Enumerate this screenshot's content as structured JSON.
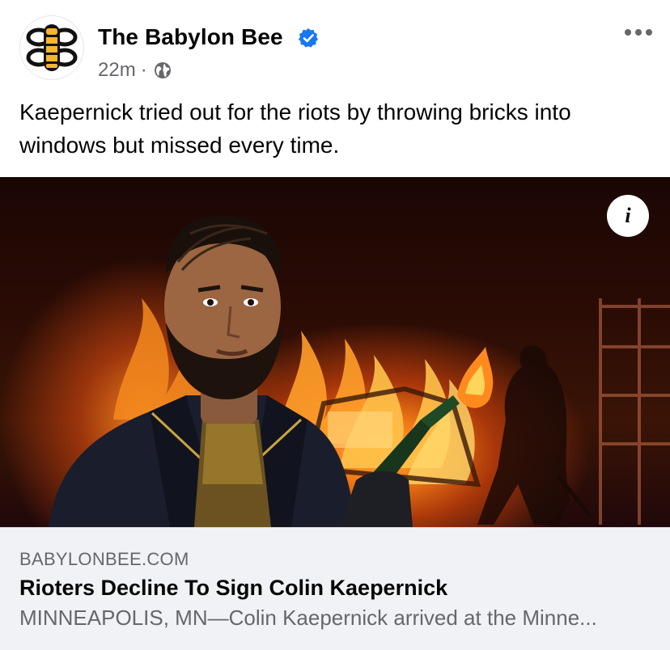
{
  "post": {
    "page_name": "The Babylon Bee",
    "verified": true,
    "time": "22m",
    "separator": "·",
    "audience_icon": "globe-icon",
    "more_icon": "more-horizontal-icon",
    "caption": "Kaepernick tried out for the riots by throwing bricks into windows but missed every time."
  },
  "media": {
    "info_icon": "info-icon",
    "info_label": "i"
  },
  "link_card": {
    "domain": "BABYLONBEE.COM",
    "headline": "Rioters Decline To Sign Colin Kaepernick",
    "snippet": "MINNEAPOLIS, MN—Colin Kaepernick arrived at the Minne..."
  },
  "colors": {
    "verified_blue": "#1877f2",
    "secondary_text": "#65676b",
    "card_background": "#f0f2f5",
    "bee_yellow": "#f7b52c"
  }
}
